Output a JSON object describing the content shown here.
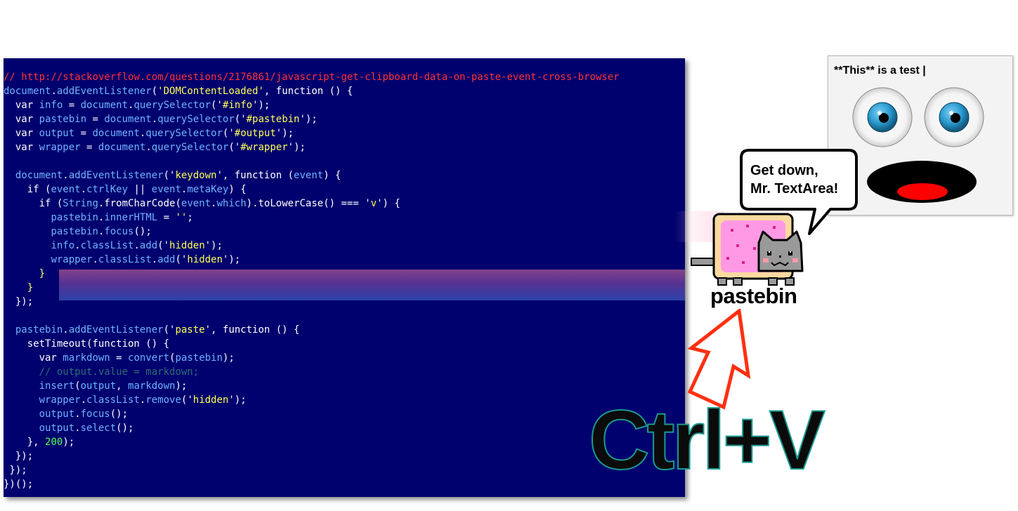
{
  "code_lines": [
    [
      {
        "t": "// ",
        "c": "tok-comment-url"
      },
      {
        "t": "http://stackoverflow.com/questions/2176861/javascript-get-clipboard-data-on-paste-event-cross-browser",
        "c": "tok-comment-url"
      }
    ],
    [
      {
        "t": "document",
        "c": "tok-prop"
      },
      {
        "t": ".",
        "c": "tok-plain"
      },
      {
        "t": "addEventListener",
        "c": "tok-prop"
      },
      {
        "t": "(",
        "c": "tok-plain"
      },
      {
        "t": "'",
        "c": "tok-string"
      },
      {
        "t": "DOMContentLoaded",
        "c": "tok-string"
      },
      {
        "t": "'",
        "c": "tok-string"
      },
      {
        "t": ", function () {",
        "c": "tok-plain"
      }
    ],
    [
      {
        "t": "  var ",
        "c": "tok-plain"
      },
      {
        "t": "info",
        "c": "tok-prop"
      },
      {
        "t": " = ",
        "c": "tok-plain"
      },
      {
        "t": "document",
        "c": "tok-prop"
      },
      {
        "t": ".",
        "c": "tok-plain"
      },
      {
        "t": "querySelector",
        "c": "tok-prop"
      },
      {
        "t": "('",
        "c": "tok-plain"
      },
      {
        "t": "#info",
        "c": "tok-string"
      },
      {
        "t": "');",
        "c": "tok-plain"
      }
    ],
    [
      {
        "t": "  var ",
        "c": "tok-plain"
      },
      {
        "t": "pastebin",
        "c": "tok-prop"
      },
      {
        "t": " = ",
        "c": "tok-plain"
      },
      {
        "t": "document",
        "c": "tok-prop"
      },
      {
        "t": ".",
        "c": "tok-plain"
      },
      {
        "t": "querySelector",
        "c": "tok-prop"
      },
      {
        "t": "('",
        "c": "tok-plain"
      },
      {
        "t": "#pastebin",
        "c": "tok-string"
      },
      {
        "t": "');",
        "c": "tok-plain"
      }
    ],
    [
      {
        "t": "  var ",
        "c": "tok-plain"
      },
      {
        "t": "output",
        "c": "tok-prop"
      },
      {
        "t": " = ",
        "c": "tok-plain"
      },
      {
        "t": "document",
        "c": "tok-prop"
      },
      {
        "t": ".",
        "c": "tok-plain"
      },
      {
        "t": "querySelector",
        "c": "tok-prop"
      },
      {
        "t": "('",
        "c": "tok-plain"
      },
      {
        "t": "#output",
        "c": "tok-string"
      },
      {
        "t": "');",
        "c": "tok-plain"
      }
    ],
    [
      {
        "t": "  var ",
        "c": "tok-plain"
      },
      {
        "t": "wrapper",
        "c": "tok-prop"
      },
      {
        "t": " = ",
        "c": "tok-plain"
      },
      {
        "t": "document",
        "c": "tok-prop"
      },
      {
        "t": ".",
        "c": "tok-plain"
      },
      {
        "t": "querySelector",
        "c": "tok-prop"
      },
      {
        "t": "('",
        "c": "tok-plain"
      },
      {
        "t": "#wrapper",
        "c": "tok-string"
      },
      {
        "t": "');",
        "c": "tok-plain"
      }
    ],
    [
      {
        "t": "",
        "c": "tok-plain"
      }
    ],
    [
      {
        "t": "  ",
        "c": "tok-plain"
      },
      {
        "t": "document",
        "c": "tok-prop"
      },
      {
        "t": ".",
        "c": "tok-plain"
      },
      {
        "t": "addEventListener",
        "c": "tok-prop"
      },
      {
        "t": "('",
        "c": "tok-plain"
      },
      {
        "t": "keydown",
        "c": "tok-string"
      },
      {
        "t": "', function (",
        "c": "tok-plain"
      },
      {
        "t": "event",
        "c": "tok-prop"
      },
      {
        "t": ") {",
        "c": "tok-plain"
      }
    ],
    [
      {
        "t": "    if (",
        "c": "tok-plain"
      },
      {
        "t": "event",
        "c": "tok-prop"
      },
      {
        "t": ".",
        "c": "tok-plain"
      },
      {
        "t": "ctrlKey",
        "c": "tok-prop"
      },
      {
        "t": " || ",
        "c": "tok-plain"
      },
      {
        "t": "event",
        "c": "tok-prop"
      },
      {
        "t": ".",
        "c": "tok-plain"
      },
      {
        "t": "metaKey",
        "c": "tok-prop"
      },
      {
        "t": ") {",
        "c": "tok-plain"
      }
    ],
    [
      {
        "t": "      if (",
        "c": "tok-plain"
      },
      {
        "t": "String",
        "c": "tok-prop"
      },
      {
        "t": ".fromCharCode(",
        "c": "tok-plain"
      },
      {
        "t": "event",
        "c": "tok-prop"
      },
      {
        "t": ".",
        "c": "tok-plain"
      },
      {
        "t": "which",
        "c": "tok-prop"
      },
      {
        "t": ").toLowerCase() === '",
        "c": "tok-plain"
      },
      {
        "t": "v",
        "c": "tok-string"
      },
      {
        "t": "') {",
        "c": "tok-plain"
      }
    ],
    [
      {
        "t": "        ",
        "c": "tok-plain"
      },
      {
        "t": "pastebin",
        "c": "tok-prop"
      },
      {
        "t": ".",
        "c": "tok-plain"
      },
      {
        "t": "innerHTML",
        "c": "tok-prop"
      },
      {
        "t": " = ",
        "c": "tok-plain"
      },
      {
        "t": "''",
        "c": "tok-string"
      },
      {
        "t": ";",
        "c": "tok-plain"
      }
    ],
    [
      {
        "t": "        ",
        "c": "tok-plain"
      },
      {
        "t": "pastebin",
        "c": "tok-prop"
      },
      {
        "t": ".",
        "c": "tok-plain"
      },
      {
        "t": "focus",
        "c": "tok-prop"
      },
      {
        "t": "();",
        "c": "tok-plain"
      }
    ],
    [
      {
        "t": "        ",
        "c": "tok-plain"
      },
      {
        "t": "info",
        "c": "tok-prop"
      },
      {
        "t": ".",
        "c": "tok-plain"
      },
      {
        "t": "classList",
        "c": "tok-prop"
      },
      {
        "t": ".",
        "c": "tok-plain"
      },
      {
        "t": "add",
        "c": "tok-prop"
      },
      {
        "t": "('",
        "c": "tok-plain"
      },
      {
        "t": "hidden",
        "c": "tok-string"
      },
      {
        "t": "');",
        "c": "tok-plain"
      }
    ],
    [
      {
        "t": "        ",
        "c": "tok-plain"
      },
      {
        "t": "wrapper",
        "c": "tok-prop"
      },
      {
        "t": ".",
        "c": "tok-plain"
      },
      {
        "t": "classList",
        "c": "tok-prop"
      },
      {
        "t": ".",
        "c": "tok-plain"
      },
      {
        "t": "add",
        "c": "tok-prop"
      },
      {
        "t": "('",
        "c": "tok-plain"
      },
      {
        "t": "hidden",
        "c": "tok-string"
      },
      {
        "t": "');",
        "c": "tok-plain"
      }
    ],
    [
      {
        "t": "      }",
        "c": "tok-punct"
      }
    ],
    [
      {
        "t": "    }",
        "c": "tok-punct"
      }
    ],
    [
      {
        "t": "  });",
        "c": "tok-plain"
      }
    ],
    [
      {
        "t": "",
        "c": "tok-plain"
      }
    ],
    [
      {
        "t": "  ",
        "c": "tok-plain"
      },
      {
        "t": "pastebin",
        "c": "tok-prop"
      },
      {
        "t": ".",
        "c": "tok-plain"
      },
      {
        "t": "addEventListener",
        "c": "tok-prop"
      },
      {
        "t": "('",
        "c": "tok-plain"
      },
      {
        "t": "paste",
        "c": "tok-string"
      },
      {
        "t": "', function () {",
        "c": "tok-plain"
      }
    ],
    [
      {
        "t": "    setTimeout(function () {",
        "c": "tok-plain"
      }
    ],
    [
      {
        "t": "      var ",
        "c": "tok-plain"
      },
      {
        "t": "markdown",
        "c": "tok-prop"
      },
      {
        "t": " = ",
        "c": "tok-plain"
      },
      {
        "t": "convert",
        "c": "tok-prop"
      },
      {
        "t": "(",
        "c": "tok-plain"
      },
      {
        "t": "pastebin",
        "c": "tok-prop"
      },
      {
        "t": ");",
        "c": "tok-plain"
      }
    ],
    [
      {
        "t": "      // output.value = markdown;",
        "c": "tok-comment"
      }
    ],
    [
      {
        "t": "      ",
        "c": "tok-plain"
      },
      {
        "t": "insert",
        "c": "tok-prop"
      },
      {
        "t": "(",
        "c": "tok-plain"
      },
      {
        "t": "output",
        "c": "tok-prop"
      },
      {
        "t": ", ",
        "c": "tok-plain"
      },
      {
        "t": "markdown",
        "c": "tok-prop"
      },
      {
        "t": ");",
        "c": "tok-plain"
      }
    ],
    [
      {
        "t": "      ",
        "c": "tok-plain"
      },
      {
        "t": "wrapper",
        "c": "tok-prop"
      },
      {
        "t": ".",
        "c": "tok-plain"
      },
      {
        "t": "classList",
        "c": "tok-prop"
      },
      {
        "t": ".",
        "c": "tok-plain"
      },
      {
        "t": "remove",
        "c": "tok-prop"
      },
      {
        "t": "('",
        "c": "tok-plain"
      },
      {
        "t": "hidden",
        "c": "tok-string"
      },
      {
        "t": "');",
        "c": "tok-plain"
      }
    ],
    [
      {
        "t": "      ",
        "c": "tok-plain"
      },
      {
        "t": "output",
        "c": "tok-prop"
      },
      {
        "t": ".",
        "c": "tok-plain"
      },
      {
        "t": "focus",
        "c": "tok-prop"
      },
      {
        "t": "();",
        "c": "tok-plain"
      }
    ],
    [
      {
        "t": "      ",
        "c": "tok-plain"
      },
      {
        "t": "output",
        "c": "tok-prop"
      },
      {
        "t": ".",
        "c": "tok-plain"
      },
      {
        "t": "select",
        "c": "tok-prop"
      },
      {
        "t": "();",
        "c": "tok-plain"
      }
    ],
    [
      {
        "t": "    }, ",
        "c": "tok-plain"
      },
      {
        "t": "200",
        "c": "tok-number"
      },
      {
        "t": ");",
        "c": "tok-plain"
      }
    ],
    [
      {
        "t": "  });",
        "c": "tok-plain"
      }
    ],
    [
      {
        "t": " });",
        "c": "tok-plain"
      }
    ],
    [
      {
        "t": "})();",
        "c": "tok-plain"
      }
    ]
  ],
  "preview": {
    "text": "**This** is a test |"
  },
  "speech_bubble": {
    "text": "Get down,\nMr. TextArea!"
  },
  "pastebin_label": "pastebin",
  "shortcut_label": "Ctrl+V",
  "colors": {
    "code_background": "#00006e",
    "arrow": "#ff3010",
    "eye_iris": "#2a9bd0",
    "mouth": "#000000",
    "tongue": "#ff0000",
    "cat_pink": "#ff99e6",
    "cat_gray": "#999999"
  },
  "icons": [
    "surprised-face-icon",
    "nyan-cat-icon",
    "speech-bubble-icon",
    "red-arrow-icon"
  ]
}
